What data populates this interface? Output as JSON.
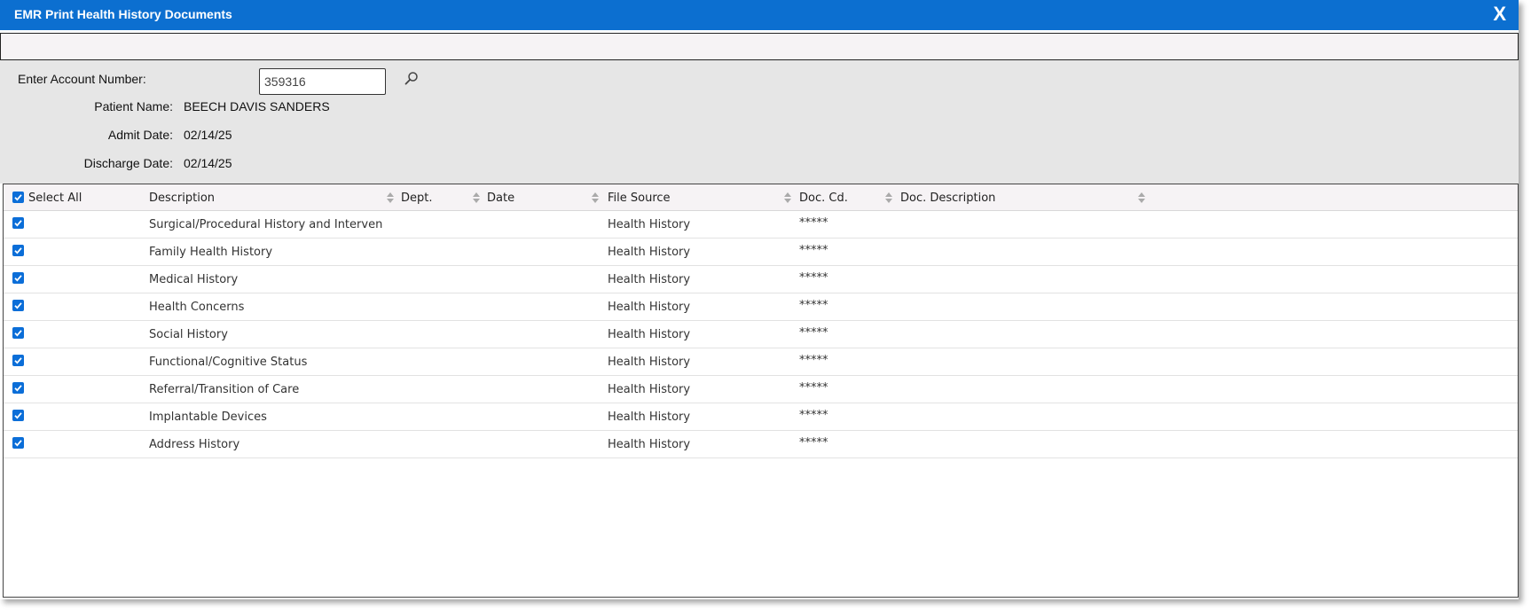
{
  "window": {
    "title": "EMR Print Health History Documents",
    "close_label": "X"
  },
  "info": {
    "account_label": "Enter Account Number:",
    "account_value": "359316",
    "patient_name_label": "Patient Name:",
    "patient_name": "BEECH DAVIS SANDERS",
    "admit_date_label": "Admit Date:",
    "admit_date": "02/14/25",
    "discharge_date_label": "Discharge Date:",
    "discharge_date": "02/14/25"
  },
  "grid": {
    "select_all_label": "Select All",
    "select_all_checked": true,
    "columns": [
      "Description",
      "Dept.",
      "Date",
      "File Source",
      "Doc. Cd.",
      "Doc. Description"
    ],
    "rows": [
      {
        "checked": true,
        "description": "Surgical/Procedural History and Interven",
        "dept": "",
        "date": "",
        "file_source": "Health History",
        "doc_cd": "*****",
        "doc_description": ""
      },
      {
        "checked": true,
        "description": "Family Health History",
        "dept": "",
        "date": "",
        "file_source": "Health History",
        "doc_cd": "*****",
        "doc_description": ""
      },
      {
        "checked": true,
        "description": "Medical History",
        "dept": "",
        "date": "",
        "file_source": "Health History",
        "doc_cd": "*****",
        "doc_description": ""
      },
      {
        "checked": true,
        "description": "Health Concerns",
        "dept": "",
        "date": "",
        "file_source": "Health History",
        "doc_cd": "*****",
        "doc_description": ""
      },
      {
        "checked": true,
        "description": "Social History",
        "dept": "",
        "date": "",
        "file_source": "Health History",
        "doc_cd": "*****",
        "doc_description": ""
      },
      {
        "checked": true,
        "description": "Functional/Cognitive Status",
        "dept": "",
        "date": "",
        "file_source": "Health History",
        "doc_cd": "*****",
        "doc_description": ""
      },
      {
        "checked": true,
        "description": "Referral/Transition of Care",
        "dept": "",
        "date": "",
        "file_source": "Health History",
        "doc_cd": "*****",
        "doc_description": ""
      },
      {
        "checked": true,
        "description": "Implantable Devices",
        "dept": "",
        "date": "",
        "file_source": "Health History",
        "doc_cd": "*****",
        "doc_description": ""
      },
      {
        "checked": true,
        "description": "Address History",
        "dept": "",
        "date": "",
        "file_source": "Health History",
        "doc_cd": "*****",
        "doc_description": ""
      }
    ]
  },
  "icons": {
    "search": "search-icon",
    "sort": "sort-icon",
    "checkbox": "checkbox-checked-icon"
  },
  "colors": {
    "titlebar": "#0c6fd0",
    "checkbox": "#0b6ed8",
    "panel": "#e6e6e6",
    "header": "#f6f3f5"
  }
}
